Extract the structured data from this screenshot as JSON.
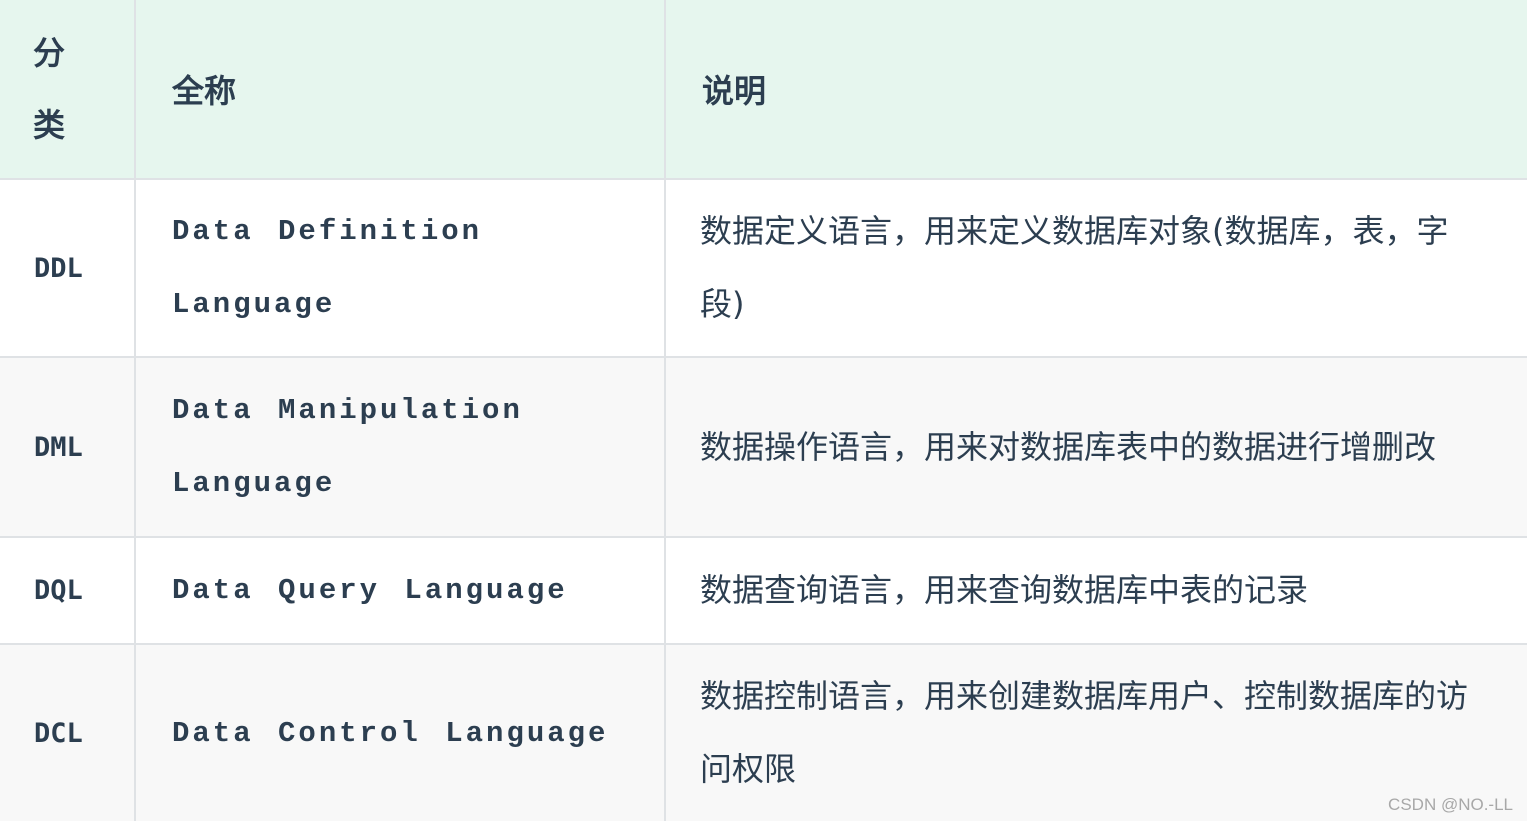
{
  "header": {
    "col1_line1": "分",
    "col1_line2": "类",
    "col2": "全称",
    "col3": "说明"
  },
  "rows": [
    {
      "abbr": "DDL",
      "full_name": "Data Definition Language",
      "description": "数据定义语言，用来定义数据库对象(数据库，表，字段)"
    },
    {
      "abbr": "DML",
      "full_name": "Data Manipulation Language",
      "description": "数据操作语言，用来对数据库表中的数据进行增删改"
    },
    {
      "abbr": "DQL",
      "full_name": "Data Query Language",
      "description": "数据查询语言，用来查询数据库中表的记录"
    },
    {
      "abbr": "DCL",
      "full_name": "Data Control Language",
      "description": "数据控制语言，用来创建数据库用户、控制数据库的访问权限"
    }
  ],
  "watermark": "CSDN @NO.-LL",
  "colors": {
    "header_bg": "#e6f6ee",
    "stripe_bg": "#f8f8f8",
    "border": "#dfe2e5",
    "text": "#2c3e50"
  }
}
